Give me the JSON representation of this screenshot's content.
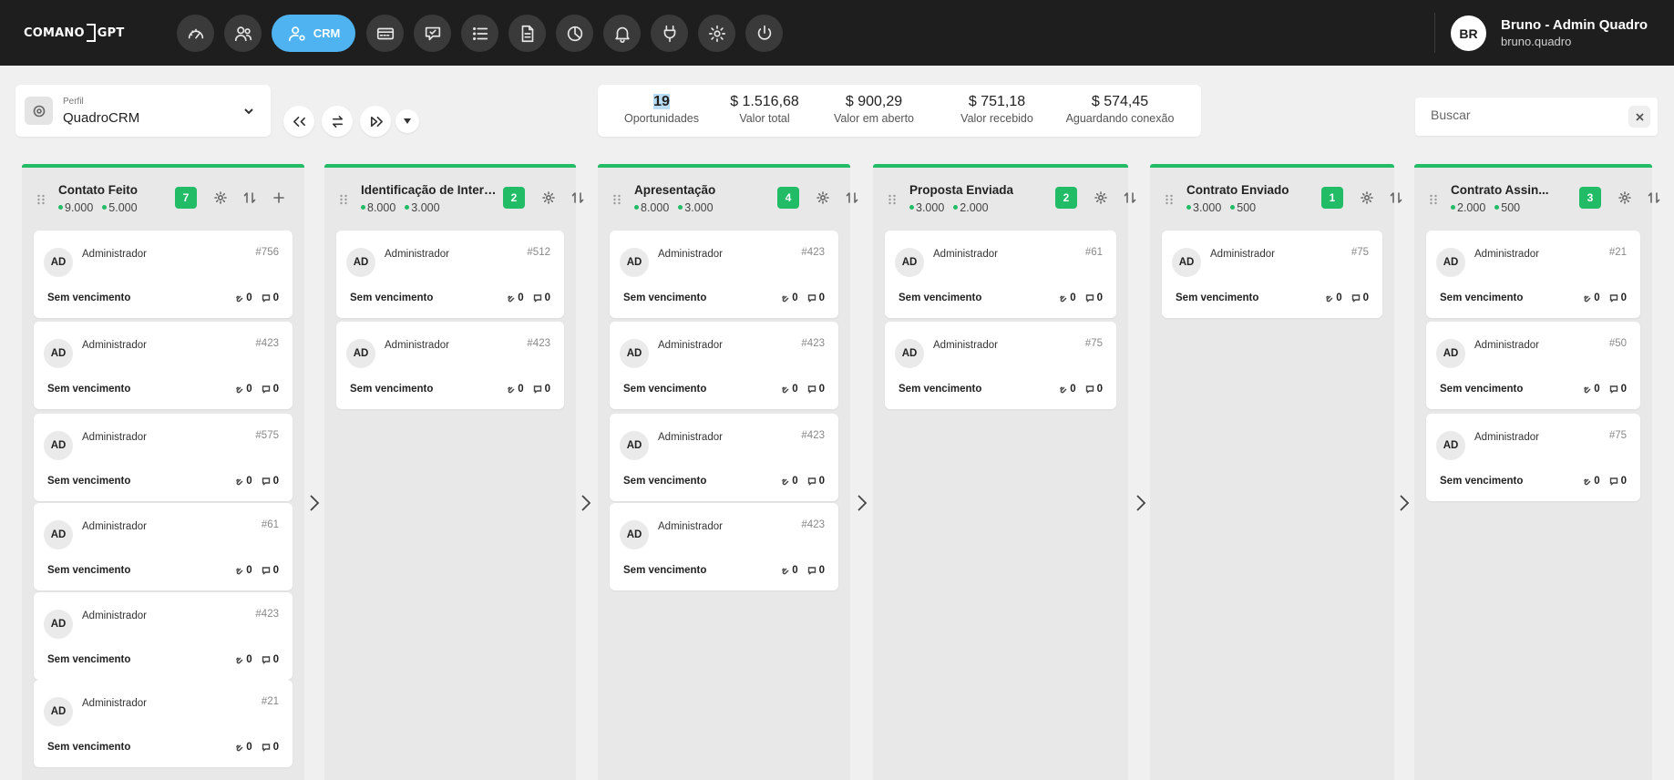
{
  "app": {
    "logo_left": "COMANO",
    "logo_right": "GPT"
  },
  "nav": {
    "items": [
      {
        "name": "dashboard",
        "icon": "gauge-icon"
      },
      {
        "name": "contacts",
        "icon": "users-icon"
      },
      {
        "name": "crm",
        "icon": "user-cog-icon",
        "label": "CRM",
        "active": true
      },
      {
        "name": "connections",
        "icon": "card-icon"
      },
      {
        "name": "messages",
        "icon": "chat-icon"
      },
      {
        "name": "lists",
        "icon": "list-icon"
      },
      {
        "name": "documents",
        "icon": "document-icon"
      },
      {
        "name": "reports",
        "icon": "pie-icon"
      },
      {
        "name": "notifications",
        "icon": "bell-icon"
      },
      {
        "name": "integrations",
        "icon": "plug-icon"
      },
      {
        "name": "settings",
        "icon": "gear-icon"
      },
      {
        "name": "logout",
        "icon": "power-icon"
      }
    ]
  },
  "user": {
    "initials": "BR",
    "name": "Bruno - Admin Quadro",
    "email": "bruno.quadro"
  },
  "profile": {
    "label": "Perfil",
    "value": "QuadroCRM"
  },
  "stats": [
    {
      "value": "19",
      "label": "Oportunidades"
    },
    {
      "value": "$ 1.516,68",
      "label": "Valor total"
    },
    {
      "value": "$ 900,29",
      "label": "Valor em aberto"
    },
    {
      "value": "$ 751,18",
      "label": "Valor recebido"
    },
    {
      "value": "$ 574,45",
      "label": "Aguardando conexão"
    }
  ],
  "search": {
    "placeholder": "Buscar"
  },
  "columns": [
    {
      "title": "Contato Feito",
      "v1": "9.000",
      "v2": "5.000",
      "count": "7",
      "cards": [
        {
          "initials": "AD",
          "user": "Administrador",
          "id": "#756",
          "due": "Sem vencimento",
          "a": "0",
          "c": "0"
        },
        {
          "initials": "AD",
          "user": "Administrador",
          "id": "#423",
          "due": "Sem vencimento",
          "a": "0",
          "c": "0"
        },
        {
          "initials": "AD",
          "user": "Administrador",
          "id": "#575",
          "due": "Sem vencimento",
          "a": "0",
          "c": "0"
        },
        {
          "initials": "AD",
          "user": "Administrador",
          "id": "#61",
          "due": "Sem vencimento",
          "a": "0",
          "c": "0"
        },
        {
          "initials": "AD",
          "user": "Administrador",
          "id": "#423",
          "due": "Sem vencimento",
          "a": "0",
          "c": "0"
        },
        {
          "initials": "AD",
          "user": "Administrador",
          "id": "#21",
          "due": "Sem vencimento",
          "a": "0",
          "c": "0"
        }
      ]
    },
    {
      "title": "Identificação de Intere...",
      "v1": "8.000",
      "v2": "3.000",
      "count": "2",
      "cards": [
        {
          "initials": "AD",
          "user": "Administrador",
          "id": "#512",
          "due": "Sem vencimento",
          "a": "0",
          "c": "0"
        },
        {
          "initials": "AD",
          "user": "Administrador",
          "id": "#423",
          "due": "Sem vencimento",
          "a": "0",
          "c": "0"
        }
      ]
    },
    {
      "title": "Apresentação",
      "v1": "8.000",
      "v2": "3.000",
      "count": "4",
      "cards": [
        {
          "initials": "AD",
          "user": "Administrador",
          "id": "#423",
          "due": "Sem vencimento",
          "a": "0",
          "c": "0"
        },
        {
          "initials": "AD",
          "user": "Administrador",
          "id": "#423",
          "due": "Sem vencimento",
          "a": "0",
          "c": "0"
        },
        {
          "initials": "AD",
          "user": "Administrador",
          "id": "#423",
          "due": "Sem vencimento",
          "a": "0",
          "c": "0"
        },
        {
          "initials": "AD",
          "user": "Administrador",
          "id": "#423",
          "due": "Sem vencimento",
          "a": "0",
          "c": "0"
        }
      ]
    },
    {
      "title": "Proposta Enviada",
      "v1": "3.000",
      "v2": "2.000",
      "count": "2",
      "cards": [
        {
          "initials": "AD",
          "user": "Administrador",
          "id": "#61",
          "due": "Sem vencimento",
          "a": "0",
          "c": "0"
        },
        {
          "initials": "AD",
          "user": "Administrador",
          "id": "#75",
          "due": "Sem vencimento",
          "a": "0",
          "c": "0"
        }
      ]
    },
    {
      "title": "Contrato Enviado",
      "v1": "3.000",
      "v2": "500",
      "count": "1",
      "cards": [
        {
          "initials": "AD",
          "user": "Administrador",
          "id": "#75",
          "due": "Sem vencimento",
          "a": "0",
          "c": "0"
        }
      ]
    },
    {
      "title": "Contrato Assin...",
      "v1": "2.000",
      "v2": "500",
      "count": "3",
      "cards": [
        {
          "initials": "AD",
          "user": "Administrador",
          "id": "#21",
          "due": "Sem vencimento",
          "a": "0",
          "c": "0"
        },
        {
          "initials": "AD",
          "user": "Administrador",
          "id": "#50",
          "due": "Sem vencimento",
          "a": "0",
          "c": "0"
        },
        {
          "initials": "AD",
          "user": "Administrador",
          "id": "#75",
          "due": "Sem vencimento",
          "a": "0",
          "c": "0"
        }
      ]
    }
  ],
  "colors": {
    "accent": "#22bb66",
    "crm_button": "#4fb3f2",
    "topbar": "#1e1e1e"
  }
}
